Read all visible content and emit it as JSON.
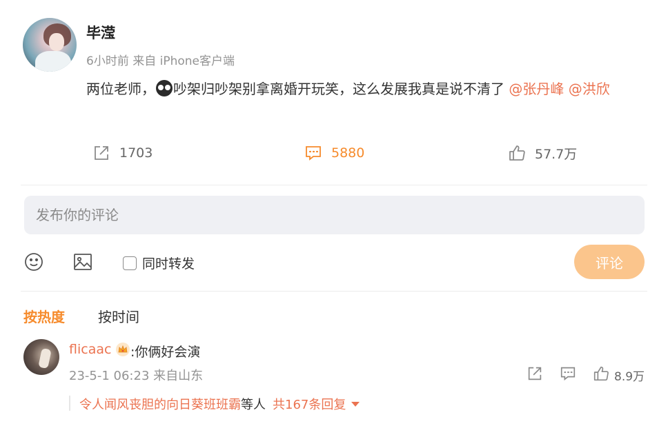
{
  "post": {
    "username": "毕滢",
    "meta": "6小时前 来自 iPhone客户端",
    "text_part1": "两位老师，",
    "text_part2": "吵架归吵架别拿离婚开玩笑，这么发展我真是说不清了 ",
    "mention1": "@张丹峰",
    "mention2": "@洪欣",
    "stats": {
      "reposts": "1703",
      "comments": "5880",
      "likes": "57.7万"
    }
  },
  "composer": {
    "placeholder": "发布你的评论",
    "repost_label": "同时转发",
    "submit_label": "评论"
  },
  "sort": {
    "hot": "按热度",
    "time": "按时间"
  },
  "comment": {
    "username": "flicaac",
    "text": ":你俩好会演",
    "meta": "23-5-1 06:23 来自山东",
    "likes": "8.9万",
    "reply_user": "令人闻风丧胆的向日葵班班霸",
    "reply_etc": " 等人",
    "reply_count": "共167条回复"
  },
  "colors": {
    "accent_orange": "#f68b2c",
    "mention": "#eb7350",
    "button_disabled": "#fbc58c",
    "input_bg": "#eff0f4"
  }
}
